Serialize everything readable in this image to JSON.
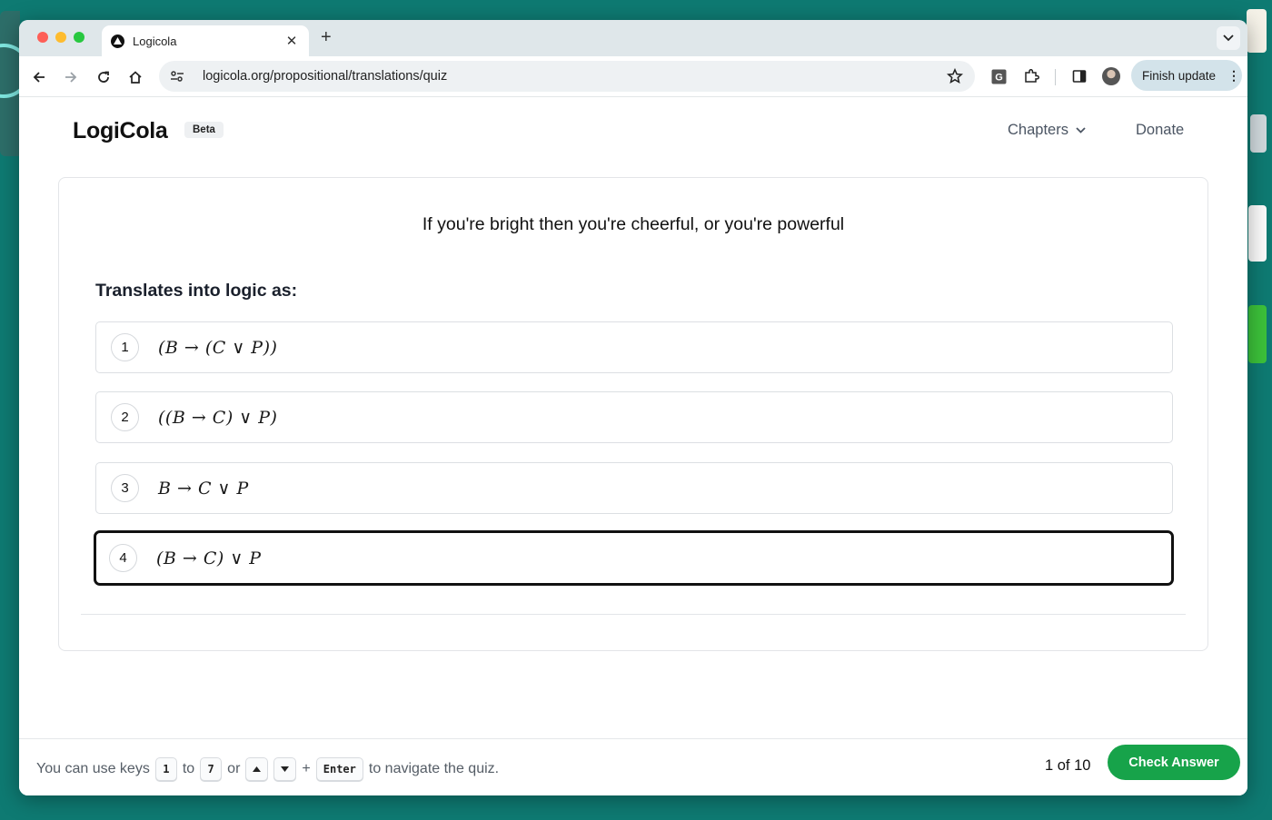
{
  "browser": {
    "tab_title": "Logicola",
    "url": "logicola.org/propositional/translations/quiz",
    "finish_update_label": "Finish update"
  },
  "site": {
    "logo": "LogiCola",
    "badge": "Beta",
    "nav": {
      "chapters": "Chapters",
      "donate": "Donate"
    }
  },
  "quiz": {
    "question": "If you're bright then you're cheerful, or you're powerful",
    "prompt": "Translates into logic as:",
    "options": [
      {
        "number": "1",
        "formula": "(B → (C ∨ P))"
      },
      {
        "number": "2",
        "formula": "((B → C) ∨ P)"
      },
      {
        "number": "3",
        "formula": "B → C ∨ P"
      },
      {
        "number": "4",
        "formula": "(B → C) ∨ P"
      }
    ],
    "selected_option": "4"
  },
  "footer": {
    "hint_prefix": "You can use keys",
    "key_from": "1",
    "to_word": "to",
    "key_to": "7",
    "or_word": "or",
    "plus_word": "+",
    "enter_key": "Enter",
    "hint_suffix": "to navigate the quiz.",
    "progress": "1 of 10",
    "check_label": "Check Answer"
  },
  "colors": {
    "desktop": "#0e7a72",
    "accent_green": "#17a34a",
    "selected_border": "#111111"
  }
}
